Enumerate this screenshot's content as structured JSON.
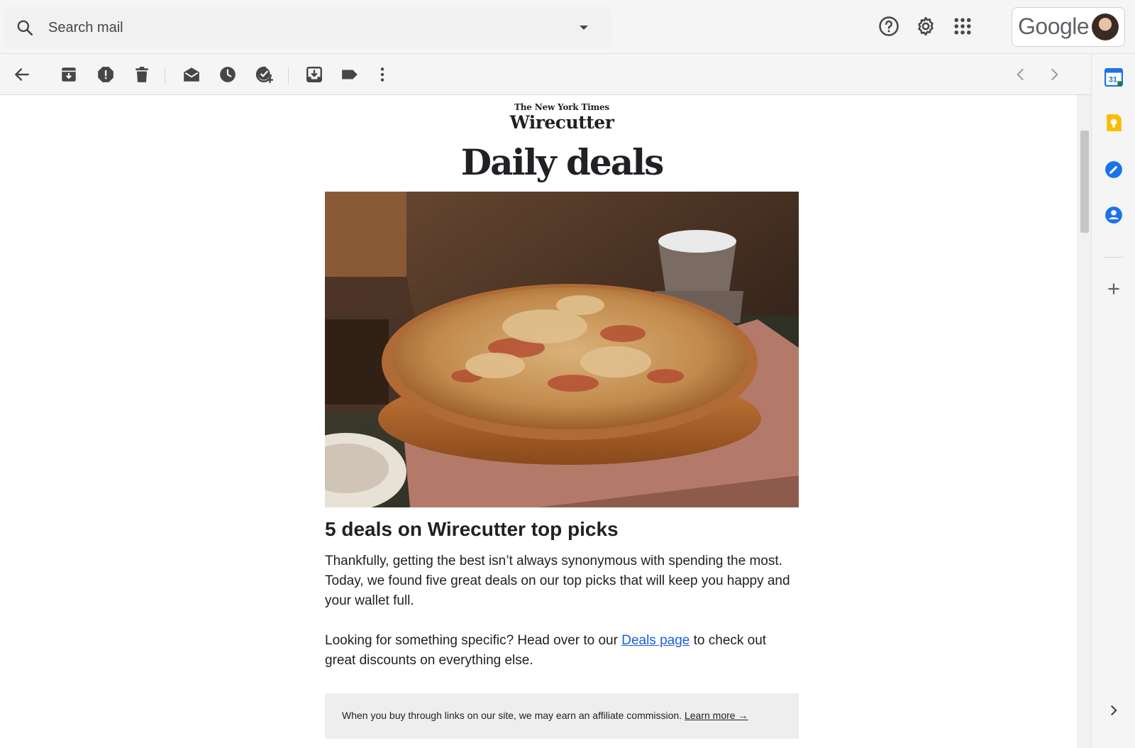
{
  "search": {
    "placeholder": "Search mail"
  },
  "header": {
    "brand": "Google"
  },
  "email": {
    "publisher_small": "The New York Times",
    "publisher_brand": "Wirecutter",
    "title": "Daily deals",
    "headline": "5 deals on Wirecutter top picks",
    "paragraph1": "Thankfully, getting the best isn’t always synonymous with spending the most. Today, we found five great deals on our top picks that will keep you happy and your wallet full.",
    "paragraph2_before": "Looking for something specific? Head over to our ",
    "paragraph2_link": "Deals page",
    "paragraph2_after": " to check out great discounts on everything else.",
    "affiliate_text": "When you buy through links on our site, we may earn an affiliate commission. ",
    "affiliate_link": "Learn more →"
  },
  "icons": {
    "topbar": [
      "search-icon",
      "chevron-down-icon",
      "help-icon",
      "settings-icon",
      "apps-grid-icon"
    ],
    "toolbar": [
      "back-arrow-icon",
      "archive-icon",
      "report-spam-icon",
      "delete-icon",
      "mark-unread-icon",
      "snooze-icon",
      "add-task-icon",
      "move-to-icon",
      "label-icon",
      "more-vert-icon",
      "previous-icon",
      "next-icon"
    ],
    "rail": [
      "calendar-icon",
      "keep-icon",
      "tasks-icon",
      "contacts-icon",
      "add-addon-icon",
      "expand-panel-icon"
    ]
  },
  "colors": {
    "link": "#1a5fe0",
    "calendar_blue": "#1a73e8",
    "keep_yellow": "#fbbc04",
    "affiliate_bg": "#eeeeee"
  }
}
